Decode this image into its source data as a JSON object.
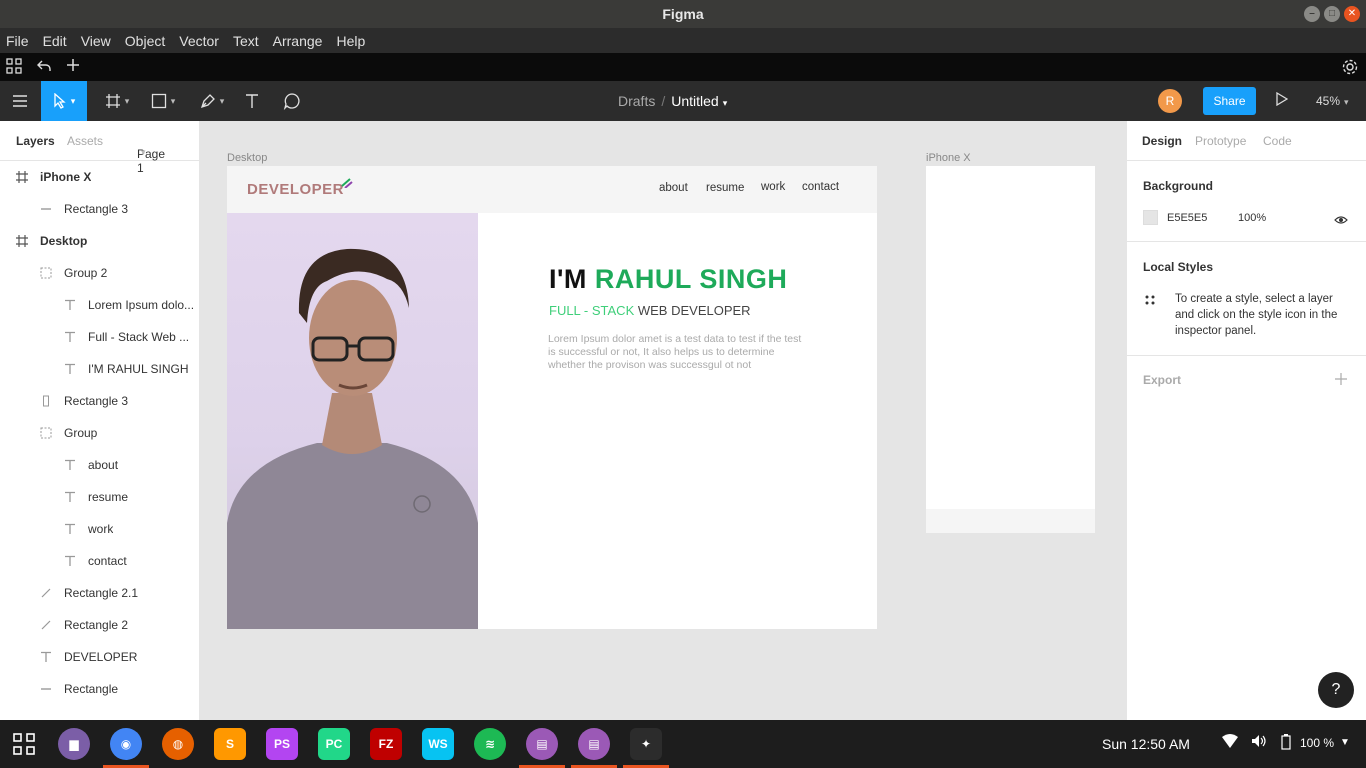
{
  "window": {
    "title": "Figma"
  },
  "menu": [
    "File",
    "Edit",
    "View",
    "Object",
    "Vector",
    "Text",
    "Arrange",
    "Help"
  ],
  "breadcrumb": {
    "project": "Drafts",
    "separator": "/",
    "file": "Untitled"
  },
  "header": {
    "avatar_initial": "R",
    "share_label": "Share",
    "zoom": "45%"
  },
  "left_panel": {
    "tabs": {
      "layers": "Layers",
      "assets": "Assets",
      "page": "Page 1"
    },
    "layers": [
      {
        "label": "iPhone X",
        "icon": "frame-icon",
        "bold": true
      },
      {
        "label": "Rectangle 3",
        "icon": "line-icon"
      },
      {
        "label": "Desktop",
        "icon": "frame-icon",
        "bold": true
      },
      {
        "label": "Group 2",
        "icon": "group-icon"
      },
      {
        "label": "Lorem Ipsum dolo...",
        "icon": "text-icon"
      },
      {
        "label": "Full - Stack Web ...",
        "icon": "text-icon"
      },
      {
        "label": "I'M RAHUL SINGH",
        "icon": "text-icon"
      },
      {
        "label": "Rectangle 3",
        "icon": "rectangle-icon"
      },
      {
        "label": "Group",
        "icon": "group-icon"
      },
      {
        "label": "about",
        "icon": "text-icon"
      },
      {
        "label": "resume",
        "icon": "text-icon"
      },
      {
        "label": "work",
        "icon": "text-icon"
      },
      {
        "label": "contact",
        "icon": "text-icon"
      },
      {
        "label": "Rectangle 2.1",
        "icon": "vector-icon"
      },
      {
        "label": "Rectangle 2",
        "icon": "vector-icon"
      },
      {
        "label": "DEVELOPER",
        "icon": "text-icon"
      },
      {
        "label": "Rectangle",
        "icon": "line-icon"
      }
    ]
  },
  "canvas": {
    "desktop_label": "Desktop",
    "iphone_label": "iPhone X",
    "site": {
      "logo": "DEVELOPER",
      "nav": [
        "about",
        "resume",
        "work",
        "contact"
      ],
      "title_prefix": "I'M ",
      "title_name": "RAHUL SINGH",
      "subtitle_accent": "FULL - STACK",
      "subtitle_rest": " WEB DEVELOPER",
      "body": "Lorem Ipsum dolor amet is a test data to test if the test is successful or not, It also helps us to determine whether the provison was successgul ot not"
    }
  },
  "right_panel": {
    "tabs": {
      "design": "Design",
      "prototype": "Prototype",
      "code": "Code"
    },
    "background": {
      "title": "Background",
      "hex": "E5E5E5",
      "opacity": "100%"
    },
    "local_styles": {
      "title": "Local Styles",
      "hint": "To create a style, select a layer and click on the style icon in the inspector panel."
    },
    "export": {
      "title": "Export"
    }
  },
  "taskbar": {
    "clock": "Sun 12:50 AM",
    "battery": "100 %",
    "apps": [
      {
        "name": "files",
        "color": "#7b5ea7"
      },
      {
        "name": "chrome",
        "color": "#4285f4"
      },
      {
        "name": "firefox",
        "color": "#e66000"
      },
      {
        "name": "sublime-text",
        "color": "#ff9800"
      },
      {
        "name": "phpstorm",
        "color": "#b345f1"
      },
      {
        "name": "pycharm",
        "color": "#21d789"
      },
      {
        "name": "filezilla",
        "color": "#bf0000"
      },
      {
        "name": "webstorm",
        "color": "#07c3f2"
      },
      {
        "name": "spotify",
        "color": "#1db954"
      },
      {
        "name": "text-editor",
        "color": "#9b59b6"
      },
      {
        "name": "text-editor-2",
        "color": "#9b59b6"
      },
      {
        "name": "figma",
        "color": "#2c2c2c"
      }
    ]
  },
  "help_label": "?"
}
